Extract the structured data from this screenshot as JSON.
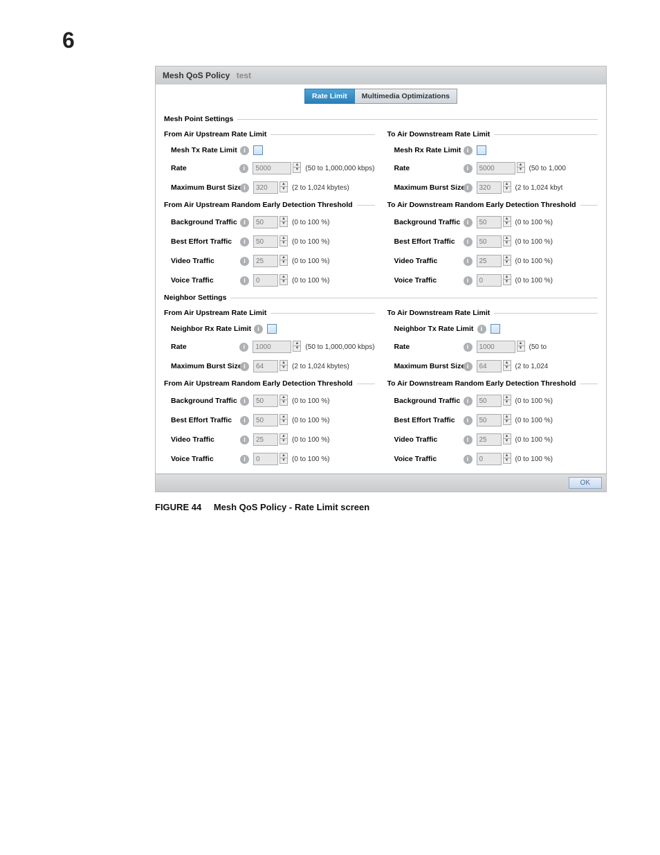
{
  "page_number": "6",
  "panel_title": "Mesh QoS Policy",
  "panel_subtitle": "test",
  "tabs": {
    "rate_limit": "Rate Limit",
    "multimedia": "Multimedia Optimizations"
  },
  "sections": {
    "mesh_point_settings": "Mesh Point Settings",
    "neighbor_settings": "Neighbor Settings"
  },
  "group_titles": {
    "from_upstream": "From Air Upstream Rate Limit",
    "to_downstream": "To Air Downstream Rate Limit",
    "from_upstream_red": "From Air Upstream Random Early Detection Threshold",
    "to_downstream_red": "To Air Downstream Random Early Detection Threshold"
  },
  "labels": {
    "mesh_tx": "Mesh Tx Rate Limit",
    "mesh_rx": "Mesh Rx Rate Limit",
    "neighbor_rx": "Neighbor Rx Rate Limit",
    "neighbor_tx": "Neighbor Tx Rate Limit",
    "rate": "Rate",
    "max_burst": "Maximum Burst Size",
    "background": "Background Traffic",
    "best_effort": "Best Effort Traffic",
    "video": "Video Traffic",
    "voice": "Voice Traffic"
  },
  "values": {
    "rate_mesh": "5000",
    "burst_mesh": "320",
    "rate_neigh": "1000",
    "burst_neigh": "64",
    "bg": "50",
    "be": "50",
    "vid": "25",
    "voi": "0"
  },
  "hints": {
    "rate_long": "(50 to 1,000,000 kbps)",
    "rate_trunc1": "(50 to 1,000",
    "rate_trunc2": "(50 to",
    "burst": "(2 to 1,024 kbytes)",
    "burst_trunc1": "(2 to 1,024 kbyt",
    "burst_trunc2": "(2 to 1,024",
    "pct": "(0 to 100 %)"
  },
  "ok": "OK",
  "caption_prefix": "FIGURE 44",
  "caption_text": "Mesh QoS Policy - Rate Limit screen"
}
